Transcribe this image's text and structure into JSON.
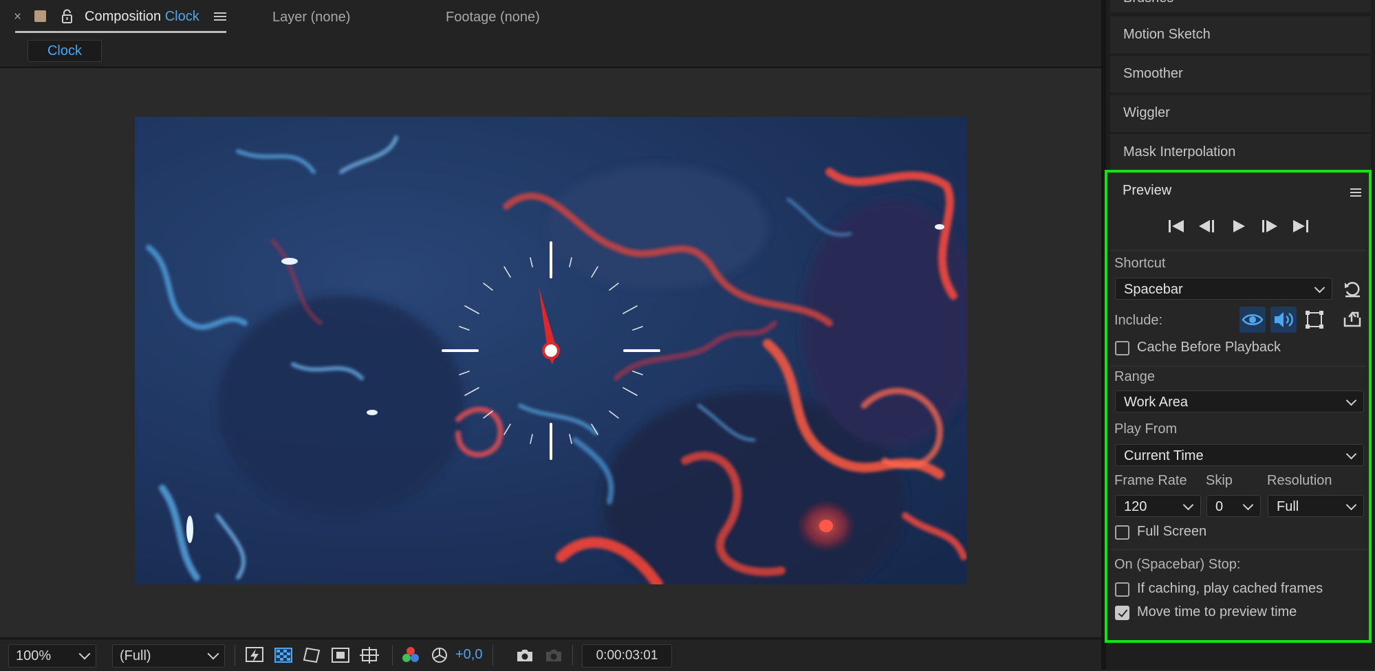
{
  "composition": {
    "tab": {
      "close_glyph": "×",
      "prefix": "Composition",
      "name": "Clock"
    },
    "other_tabs": [
      "Layer (none)",
      "Footage (none)"
    ],
    "breadcrumb": "Clock",
    "toolbar": {
      "zoom": "100%",
      "resolution": "(Full)",
      "exposure": "+0,0",
      "timecode": "0:00:03:01"
    }
  },
  "side_panels": [
    "Brushes",
    "Motion Sketch",
    "Smoother",
    "Wiggler",
    "Mask Interpolation"
  ],
  "preview": {
    "title": "Preview",
    "shortcut_label": "Shortcut",
    "shortcut_value": "Spacebar",
    "include_label": "Include:",
    "cache_before_playback": {
      "label": "Cache Before Playback",
      "checked": false
    },
    "range_label": "Range",
    "range_value": "Work Area",
    "play_from_label": "Play From",
    "play_from_value": "Current Time",
    "frame_rate_label": "Frame Rate",
    "frame_rate_value": "120",
    "skip_label": "Skip",
    "skip_value": "0",
    "resolution_label": "Resolution",
    "resolution_value": "Full",
    "full_screen": {
      "label": "Full Screen",
      "checked": false
    },
    "on_stop_label": "On (Spacebar) Stop:",
    "if_caching": {
      "label": "If caching, play cached frames",
      "checked": false
    },
    "move_time": {
      "label": "Move time to preview time",
      "checked": true
    }
  },
  "colors": {
    "accent_blue": "#4ea6f2",
    "highlight_green": "#17e017",
    "clock_hand_red": "#e0262a"
  },
  "icons": [
    "close-icon",
    "color-label-icon",
    "lock-icon",
    "panel-menu-icon",
    "first-frame-icon",
    "previous-frame-icon",
    "play-icon",
    "next-frame-icon",
    "last-frame-icon",
    "reset-icon",
    "video-icon",
    "audio-icon",
    "overlays-icon",
    "export-icon"
  ]
}
